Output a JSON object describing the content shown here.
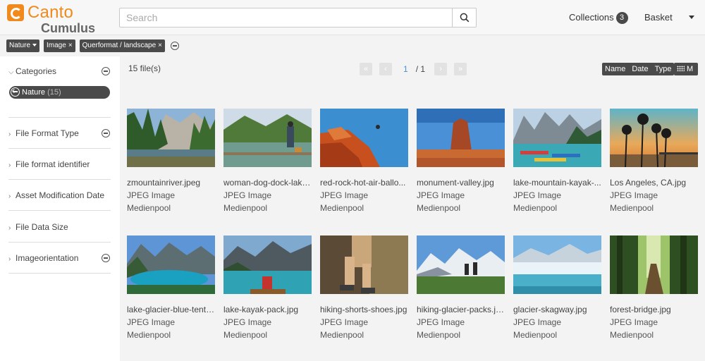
{
  "app": {
    "logo_name": "Canto",
    "logo_sub": "Cumulus",
    "brand_color": "#f08a1d"
  },
  "header": {
    "search_placeholder": "Search",
    "collections_label": "Collections",
    "collections_count": "3",
    "basket_label": "Basket"
  },
  "filters": [
    {
      "label": "Nature",
      "kind": "dropdown"
    },
    {
      "label": "Image",
      "kind": "removable"
    },
    {
      "label": "Querformat / landscape",
      "kind": "removable"
    }
  ],
  "sidebar": {
    "categories_label": "Categories",
    "active_category": "Nature",
    "active_category_count": "(15)",
    "facets": [
      {
        "label": "File Format Type",
        "has_remove": true
      },
      {
        "label": "File format identifier",
        "has_remove": false
      },
      {
        "label": "Asset Modification Date",
        "has_remove": false
      },
      {
        "label": "File Data Size",
        "has_remove": false
      },
      {
        "label": "Imageorientation",
        "has_remove": true
      }
    ]
  },
  "toolbar": {
    "file_count": "15 file(s)",
    "page_current": "1",
    "page_total": "/ 1",
    "sort_name": "Name",
    "sort_date": "Date",
    "sort_type": "Type",
    "view_size": "M"
  },
  "assets": [
    {
      "name": "zmountainriver.jpeg",
      "type": "JPEG Image",
      "pool": "Medienpool"
    },
    {
      "name": "woman-dog-dock-lake...",
      "type": "JPEG Image",
      "pool": "Medienpool"
    },
    {
      "name": "red-rock-hot-air-ballo...",
      "type": "JPEG Image",
      "pool": "Medienpool"
    },
    {
      "name": "monument-valley.jpg",
      "type": "JPEG Image",
      "pool": "Medienpool"
    },
    {
      "name": "lake-mountain-kayak-...",
      "type": "JPEG Image",
      "pool": "Medienpool"
    },
    {
      "name": "Los Angeles, CA.jpg",
      "type": "JPEG Image",
      "pool": "Medienpool"
    },
    {
      "name": "lake-glacier-blue-tent.j...",
      "type": "JPEG Image",
      "pool": "Medienpool"
    },
    {
      "name": "lake-kayak-pack.jpg",
      "type": "JPEG Image",
      "pool": "Medienpool"
    },
    {
      "name": "hiking-shorts-shoes.jpg",
      "type": "JPEG Image",
      "pool": "Medienpool"
    },
    {
      "name": "hiking-glacier-packs.jpg",
      "type": "JPEG Image",
      "pool": "Medienpool"
    },
    {
      "name": "glacier-skagway.jpg",
      "type": "JPEG Image",
      "pool": "Medienpool"
    },
    {
      "name": "forest-bridge.jpg",
      "type": "JPEG Image",
      "pool": "Medienpool"
    }
  ]
}
